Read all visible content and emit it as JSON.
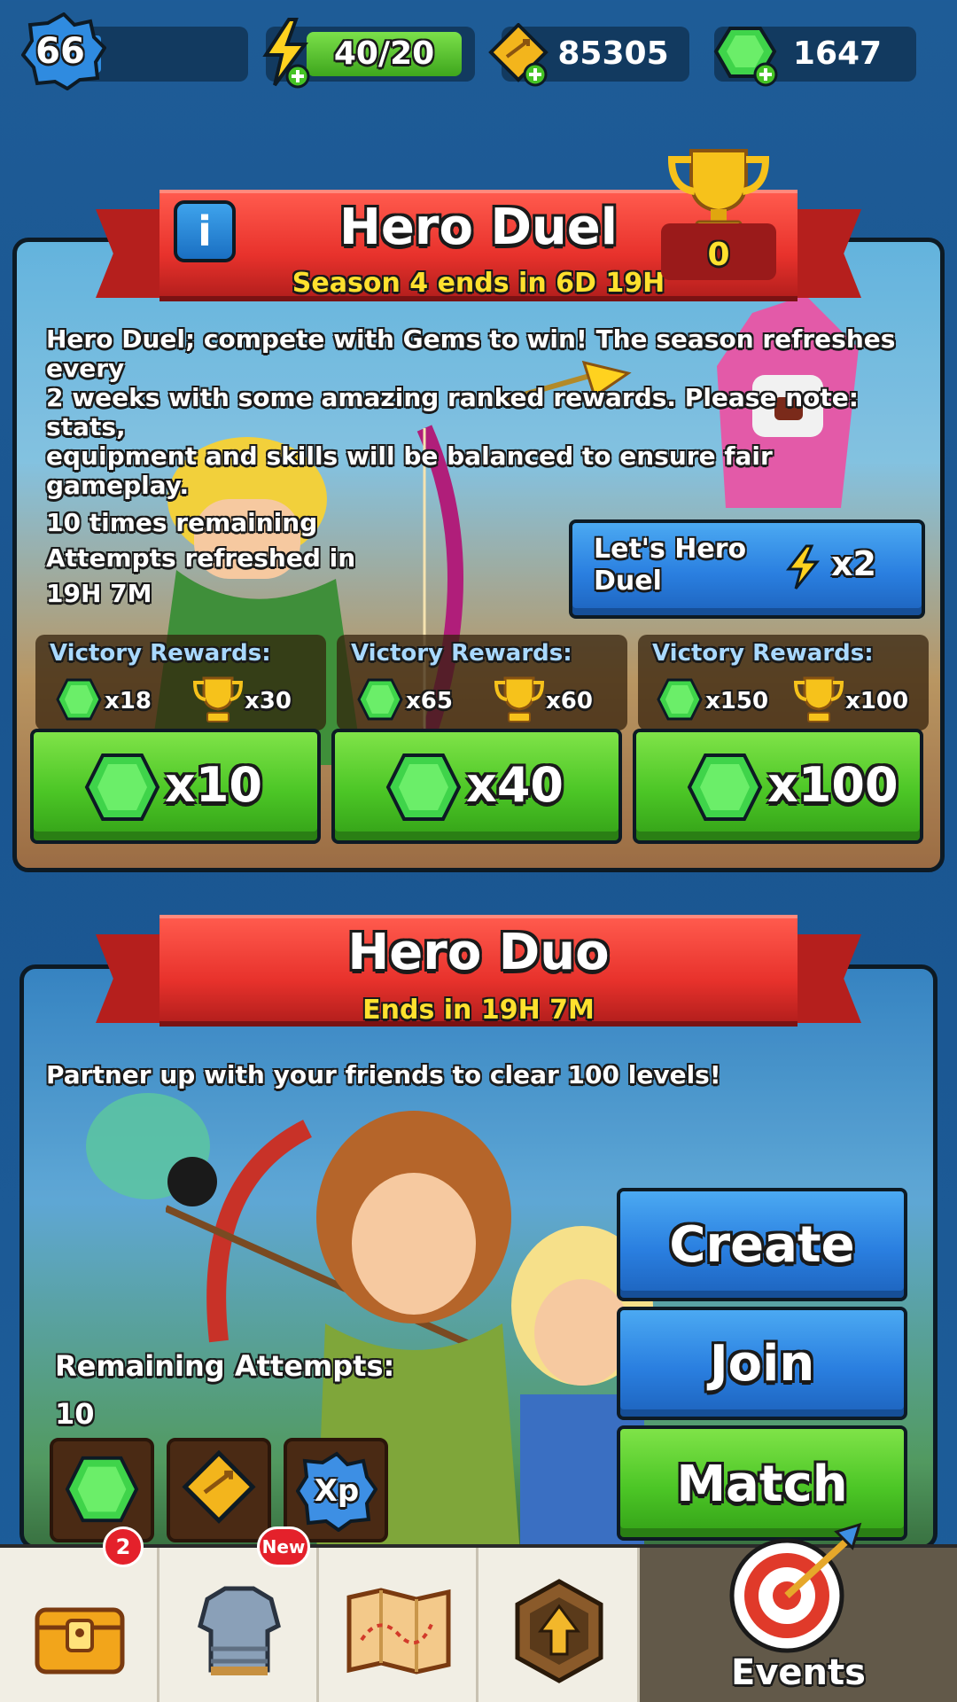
{
  "topbar": {
    "level": "66",
    "energy": "40/20",
    "coins": "85305",
    "gems": "1647",
    "level_progress": 0.08
  },
  "hero_duel": {
    "title": "Hero Duel",
    "subtitle": "Season 4 ends in 6D 19H",
    "trophy_count": "0",
    "description_lines": [
      "Hero Duel; compete with Gems to win! The season refreshes every",
      "2 weeks with some amazing ranked rewards. Please note: stats,",
      "equipment and skills will be balanced to ensure fair gameplay."
    ],
    "remaining_lines": [
      "10 times remaining",
      "Attempts refreshed in",
      "19H 7M"
    ],
    "play_button": {
      "label_line1": "Let's Hero",
      "label_line2": "Duel",
      "cost": "x2"
    },
    "tiers": [
      {
        "rewards_title": "Victory Rewards:",
        "gem_reward": "x18",
        "trophy_reward": "x30",
        "entry_cost": "x10"
      },
      {
        "rewards_title": "Victory Rewards:",
        "gem_reward": "x65",
        "trophy_reward": "x60",
        "entry_cost": "x40"
      },
      {
        "rewards_title": "Victory Rewards:",
        "gem_reward": "x150",
        "trophy_reward": "x100",
        "entry_cost": "x100"
      }
    ]
  },
  "hero_duo": {
    "title": "Hero Duo",
    "subtitle": "Ends in 19H 7M",
    "description": "Partner up with your friends to clear 100 levels!",
    "remaining_label": "Remaining Attempts:",
    "remaining_value": "10",
    "buttons": {
      "create": "Create",
      "join": "Join",
      "match": "Match"
    },
    "reward_icons": [
      "gem-icon",
      "coin-icon",
      "xp-icon"
    ],
    "xp_label": "Xp"
  },
  "bottom_nav": {
    "chest_badge": "2",
    "equipment_badge": "New",
    "events_label": "Events",
    "tabs": [
      "chest-icon",
      "armor-icon",
      "map-icon",
      "upgrade-icon",
      "target-icon"
    ]
  },
  "colors": {
    "ribbon_red": "#e8322c",
    "subtitle_yellow": "#ffe12e",
    "button_green": "#4cc626",
    "button_blue": "#2a7fe0",
    "gem_green": "#3fd44a"
  }
}
